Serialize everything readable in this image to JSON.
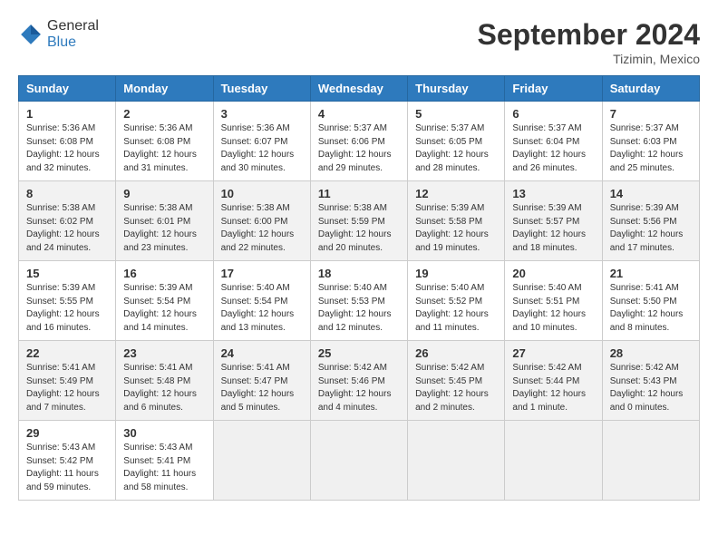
{
  "header": {
    "logo_general": "General",
    "logo_blue": "Blue",
    "month": "September 2024",
    "location": "Tizimin, Mexico"
  },
  "days_of_week": [
    "Sunday",
    "Monday",
    "Tuesday",
    "Wednesday",
    "Thursday",
    "Friday",
    "Saturday"
  ],
  "weeks": [
    {
      "cells": [
        {
          "day": "1",
          "info": "Sunrise: 5:36 AM\nSunset: 6:08 PM\nDaylight: 12 hours and 32 minutes."
        },
        {
          "day": "2",
          "info": "Sunrise: 5:36 AM\nSunset: 6:08 PM\nDaylight: 12 hours and 31 minutes."
        },
        {
          "day": "3",
          "info": "Sunrise: 5:36 AM\nSunset: 6:07 PM\nDaylight: 12 hours and 30 minutes."
        },
        {
          "day": "4",
          "info": "Sunrise: 5:37 AM\nSunset: 6:06 PM\nDaylight: 12 hours and 29 minutes."
        },
        {
          "day": "5",
          "info": "Sunrise: 5:37 AM\nSunset: 6:05 PM\nDaylight: 12 hours and 28 minutes."
        },
        {
          "day": "6",
          "info": "Sunrise: 5:37 AM\nSunset: 6:04 PM\nDaylight: 12 hours and 26 minutes."
        },
        {
          "day": "7",
          "info": "Sunrise: 5:37 AM\nSunset: 6:03 PM\nDaylight: 12 hours and 25 minutes."
        }
      ]
    },
    {
      "cells": [
        {
          "day": "8",
          "info": "Sunrise: 5:38 AM\nSunset: 6:02 PM\nDaylight: 12 hours and 24 minutes."
        },
        {
          "day": "9",
          "info": "Sunrise: 5:38 AM\nSunset: 6:01 PM\nDaylight: 12 hours and 23 minutes."
        },
        {
          "day": "10",
          "info": "Sunrise: 5:38 AM\nSunset: 6:00 PM\nDaylight: 12 hours and 22 minutes."
        },
        {
          "day": "11",
          "info": "Sunrise: 5:38 AM\nSunset: 5:59 PM\nDaylight: 12 hours and 20 minutes."
        },
        {
          "day": "12",
          "info": "Sunrise: 5:39 AM\nSunset: 5:58 PM\nDaylight: 12 hours and 19 minutes."
        },
        {
          "day": "13",
          "info": "Sunrise: 5:39 AM\nSunset: 5:57 PM\nDaylight: 12 hours and 18 minutes."
        },
        {
          "day": "14",
          "info": "Sunrise: 5:39 AM\nSunset: 5:56 PM\nDaylight: 12 hours and 17 minutes."
        }
      ]
    },
    {
      "cells": [
        {
          "day": "15",
          "info": "Sunrise: 5:39 AM\nSunset: 5:55 PM\nDaylight: 12 hours and 16 minutes."
        },
        {
          "day": "16",
          "info": "Sunrise: 5:39 AM\nSunset: 5:54 PM\nDaylight: 12 hours and 14 minutes."
        },
        {
          "day": "17",
          "info": "Sunrise: 5:40 AM\nSunset: 5:54 PM\nDaylight: 12 hours and 13 minutes."
        },
        {
          "day": "18",
          "info": "Sunrise: 5:40 AM\nSunset: 5:53 PM\nDaylight: 12 hours and 12 minutes."
        },
        {
          "day": "19",
          "info": "Sunrise: 5:40 AM\nSunset: 5:52 PM\nDaylight: 12 hours and 11 minutes."
        },
        {
          "day": "20",
          "info": "Sunrise: 5:40 AM\nSunset: 5:51 PM\nDaylight: 12 hours and 10 minutes."
        },
        {
          "day": "21",
          "info": "Sunrise: 5:41 AM\nSunset: 5:50 PM\nDaylight: 12 hours and 8 minutes."
        }
      ]
    },
    {
      "cells": [
        {
          "day": "22",
          "info": "Sunrise: 5:41 AM\nSunset: 5:49 PM\nDaylight: 12 hours and 7 minutes."
        },
        {
          "day": "23",
          "info": "Sunrise: 5:41 AM\nSunset: 5:48 PM\nDaylight: 12 hours and 6 minutes."
        },
        {
          "day": "24",
          "info": "Sunrise: 5:41 AM\nSunset: 5:47 PM\nDaylight: 12 hours and 5 minutes."
        },
        {
          "day": "25",
          "info": "Sunrise: 5:42 AM\nSunset: 5:46 PM\nDaylight: 12 hours and 4 minutes."
        },
        {
          "day": "26",
          "info": "Sunrise: 5:42 AM\nSunset: 5:45 PM\nDaylight: 12 hours and 2 minutes."
        },
        {
          "day": "27",
          "info": "Sunrise: 5:42 AM\nSunset: 5:44 PM\nDaylight: 12 hours and 1 minute."
        },
        {
          "day": "28",
          "info": "Sunrise: 5:42 AM\nSunset: 5:43 PM\nDaylight: 12 hours and 0 minutes."
        }
      ]
    },
    {
      "cells": [
        {
          "day": "29",
          "info": "Sunrise: 5:43 AM\nSunset: 5:42 PM\nDaylight: 11 hours and 59 minutes."
        },
        {
          "day": "30",
          "info": "Sunrise: 5:43 AM\nSunset: 5:41 PM\nDaylight: 11 hours and 58 minutes."
        },
        {
          "day": "",
          "info": ""
        },
        {
          "day": "",
          "info": ""
        },
        {
          "day": "",
          "info": ""
        },
        {
          "day": "",
          "info": ""
        },
        {
          "day": "",
          "info": ""
        }
      ]
    }
  ]
}
